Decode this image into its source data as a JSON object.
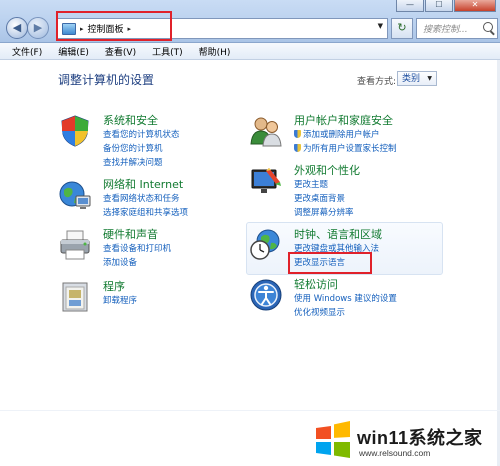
{
  "window": {
    "controls": [
      "—",
      "☐",
      "✕"
    ]
  },
  "nav": {
    "back_glyph": "◀",
    "forward_glyph": "▶"
  },
  "address": {
    "breadcrumb": "控制面板",
    "separator": "▸",
    "dropdown_glyph": "▼"
  },
  "refresh_glyph": "↻",
  "search": {
    "placeholder": "搜索控制..."
  },
  "menu": {
    "items": [
      "文件(F)",
      "编辑(E)",
      "查看(V)",
      "工具(T)",
      "帮助(H)"
    ]
  },
  "main": {
    "title": "调整计算机的设置",
    "view_by_label": "查看方式:",
    "view_by_value": "类别"
  },
  "categories": [
    {
      "title": "系统和安全",
      "icon": "shield-flag-icon",
      "links": [
        "查看您的计算机状态",
        "备份您的计算机",
        "查找并解决问题"
      ]
    },
    {
      "title": "网络和 Internet",
      "icon": "network-globe-icon",
      "links": [
        "查看网络状态和任务",
        "选择家庭组和共享选项"
      ]
    },
    {
      "title": "硬件和声音",
      "icon": "printer-icon",
      "links": [
        "查看设备和打印机",
        "添加设备"
      ]
    },
    {
      "title": "程序",
      "icon": "programs-icon",
      "links": [
        "卸载程序"
      ]
    },
    {
      "title": "用户帐户和家庭安全",
      "icon": "users-icon",
      "links": [
        "添加或删除用户帐户",
        "为所有用户设置家长控制"
      ]
    },
    {
      "title": "外观和个性化",
      "icon": "appearance-icon",
      "links": [
        "更改主题",
        "更改桌面背景",
        "调整屏幕分辨率"
      ]
    },
    {
      "title": "时钟、语言和区域",
      "icon": "clock-globe-icon",
      "links": [
        "更改键盘或其他输入法",
        "更改显示语言"
      ]
    },
    {
      "title": "轻松访问",
      "icon": "ease-of-access-icon",
      "links": [
        "使用 Windows 建议的设置",
        "优化视频显示"
      ]
    }
  ],
  "watermark": {
    "brand": "win11系统之家",
    "url": "www.relsound.com"
  },
  "colors": {
    "category_title": "#117a30",
    "link": "#1560bd",
    "highlight_box": "#e0212a",
    "page_title": "#1e3f80"
  }
}
